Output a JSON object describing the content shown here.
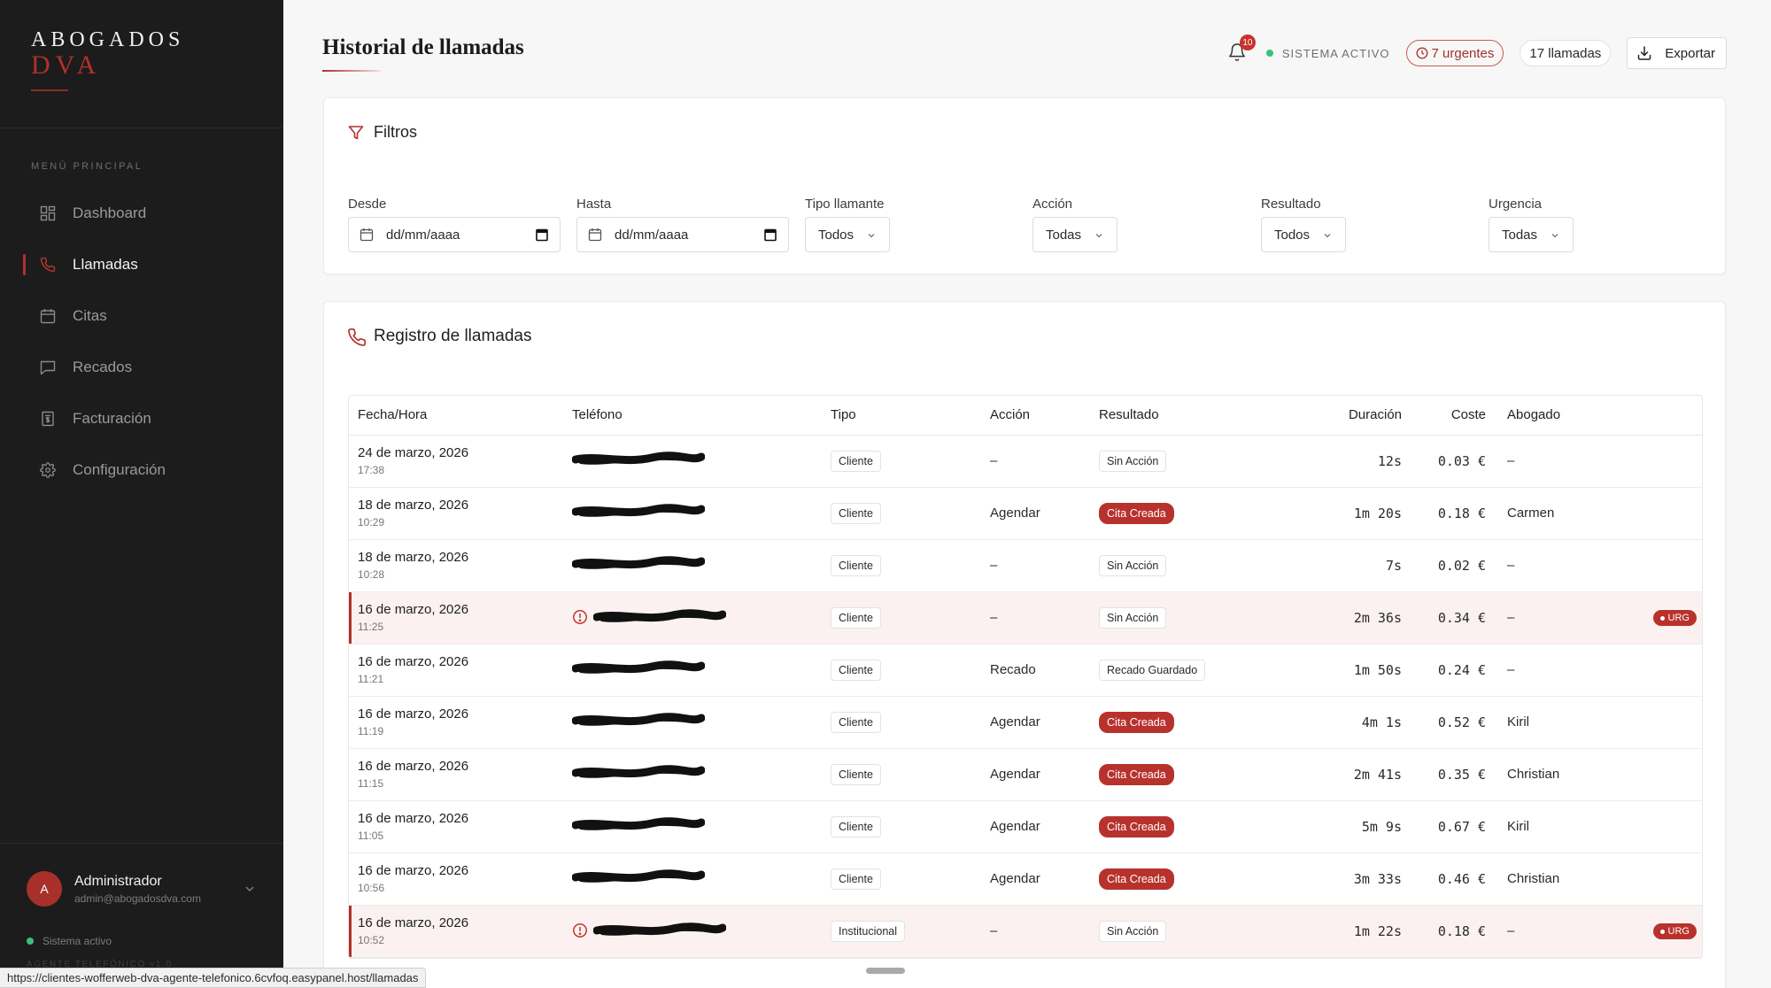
{
  "brand": {
    "line1": "ABOGADOS",
    "line2": "DVA"
  },
  "sidebar": {
    "heading": "MENÚ PRINCIPAL",
    "items": [
      {
        "label": "Dashboard",
        "icon": "dashboard-icon",
        "active": false
      },
      {
        "label": "Llamadas",
        "icon": "phone-icon",
        "active": true
      },
      {
        "label": "Citas",
        "icon": "calendar-icon",
        "active": false
      },
      {
        "label": "Recados",
        "icon": "message-icon",
        "active": false
      },
      {
        "label": "Facturación",
        "icon": "invoice-icon",
        "active": false
      },
      {
        "label": "Configuración",
        "icon": "gear-icon",
        "active": false
      }
    ],
    "user": {
      "initial": "A",
      "name": "Administrador",
      "email": "admin@abogadosdva.com"
    },
    "system_status": "Sistema activo",
    "version": "AGENTE TELEFÓNICO v1.0"
  },
  "status_url": "https://clientes-wofferweb-dva-agente-telefonico.6cvfoq.easypanel.host/llamadas",
  "header": {
    "title": "Historial de llamadas",
    "notifications": "10",
    "system_active": "SISTEMA ACTIVO",
    "urgent_label": "7 urgentes",
    "calls_count": "17 llamadas",
    "export_label": "Exportar"
  },
  "filters": {
    "title": "Filtros",
    "desde": {
      "label": "Desde",
      "value": "dd/mm/aaaa"
    },
    "hasta": {
      "label": "Hasta",
      "value": "dd/mm/aaaa"
    },
    "tipo": {
      "label": "Tipo llamante",
      "value": "Todos"
    },
    "accion": {
      "label": "Acción",
      "value": "Todas"
    },
    "resultado": {
      "label": "Resultado",
      "value": "Todos"
    },
    "urgencia": {
      "label": "Urgencia",
      "value": "Todas"
    }
  },
  "calls": {
    "title": "Registro de llamadas",
    "columns": [
      "Fecha/Hora",
      "Teléfono",
      "Tipo",
      "Acción",
      "Resultado",
      "Duración",
      "Coste",
      "Abogado"
    ],
    "urgent_badge": "URG",
    "rows": [
      {
        "date": "24 de marzo, 2026",
        "time": "17:38",
        "phone": "••• ••• 082",
        "tipo": "Cliente",
        "accion": "–",
        "resultado": "Sin Acción",
        "result_style": "plain",
        "duracion": "12s",
        "coste": "0.03 €",
        "abogado": "–",
        "urgent": false
      },
      {
        "date": "18 de marzo, 2026",
        "time": "10:29",
        "phone": "••• ••• 060",
        "tipo": "Cliente",
        "accion": "Agendar",
        "resultado": "Cita Creada",
        "result_style": "red",
        "duracion": "1m 20s",
        "coste": "0.18 €",
        "abogado": "Carmen",
        "urgent": false
      },
      {
        "date": "18 de marzo, 2026",
        "time": "10:28",
        "phone": "••• ••• 080",
        "tipo": "Cliente",
        "accion": "–",
        "resultado": "Sin Acción",
        "result_style": "plain",
        "duracion": "7s",
        "coste": "0.02 €",
        "abogado": "–",
        "urgent": false
      },
      {
        "date": "16 de marzo, 2026",
        "time": "11:25",
        "phone": "34 660 602 659",
        "tipo": "Cliente",
        "accion": "–",
        "resultado": "Sin Acción",
        "result_style": "plain",
        "duracion": "2m 36s",
        "coste": "0.34 €",
        "abogado": "–",
        "urgent": true
      },
      {
        "date": "16 de marzo, 2026",
        "time": "11:21",
        "phone": "••• 660 602 659",
        "tipo": "Cliente",
        "accion": "Recado",
        "resultado": "Recado Guardado",
        "result_style": "plain",
        "duracion": "1m 50s",
        "coste": "0.24 €",
        "abogado": "–",
        "urgent": false
      },
      {
        "date": "16 de marzo, 2026",
        "time": "11:19",
        "phone": "+34 660 602 659",
        "tipo": "Cliente",
        "accion": "Agendar",
        "resultado": "Cita Creada",
        "result_style": "red",
        "duracion": "4m 1s",
        "coste": "0.52 €",
        "abogado": "Kiril",
        "urgent": false
      },
      {
        "date": "16 de marzo, 2026",
        "time": "11:15",
        "phone": "+34 660 602 659",
        "tipo": "Cliente",
        "accion": "Agendar",
        "resultado": "Cita Creada",
        "result_style": "red",
        "duracion": "2m 41s",
        "coste": "0.35 €",
        "abogado": "Christian",
        "urgent": false
      },
      {
        "date": "16 de marzo, 2026",
        "time": "11:05",
        "phone": "+3• ••• 602 •••",
        "tipo": "Cliente",
        "accion": "Agendar",
        "resultado": "Cita Creada",
        "result_style": "red",
        "duracion": "5m 9s",
        "coste": "0.67 €",
        "abogado": "Kiril",
        "urgent": false
      },
      {
        "date": "16 de marzo, 2026",
        "time": "10:56",
        "phone": "+34 660 602 659",
        "tipo": "Cliente",
        "accion": "Agendar",
        "resultado": "Cita Creada",
        "result_style": "red",
        "duracion": "3m 33s",
        "coste": "0.46 €",
        "abogado": "Christian",
        "urgent": false
      },
      {
        "date": "16 de marzo, 2026",
        "time": "10:52",
        "phone": "+34 ••• ••• 659",
        "tipo": "Institucional",
        "accion": "–",
        "resultado": "Sin Acción",
        "result_style": "plain",
        "duracion": "1m 22s",
        "coste": "0.18 €",
        "abogado": "–",
        "urgent": true
      }
    ]
  },
  "colors": {
    "brand_red": "#b3302b",
    "sidebar_bg": "#1c1c1c",
    "status_green": "#3bbf7a",
    "urgent_row_bg": "#fbf1f1"
  }
}
